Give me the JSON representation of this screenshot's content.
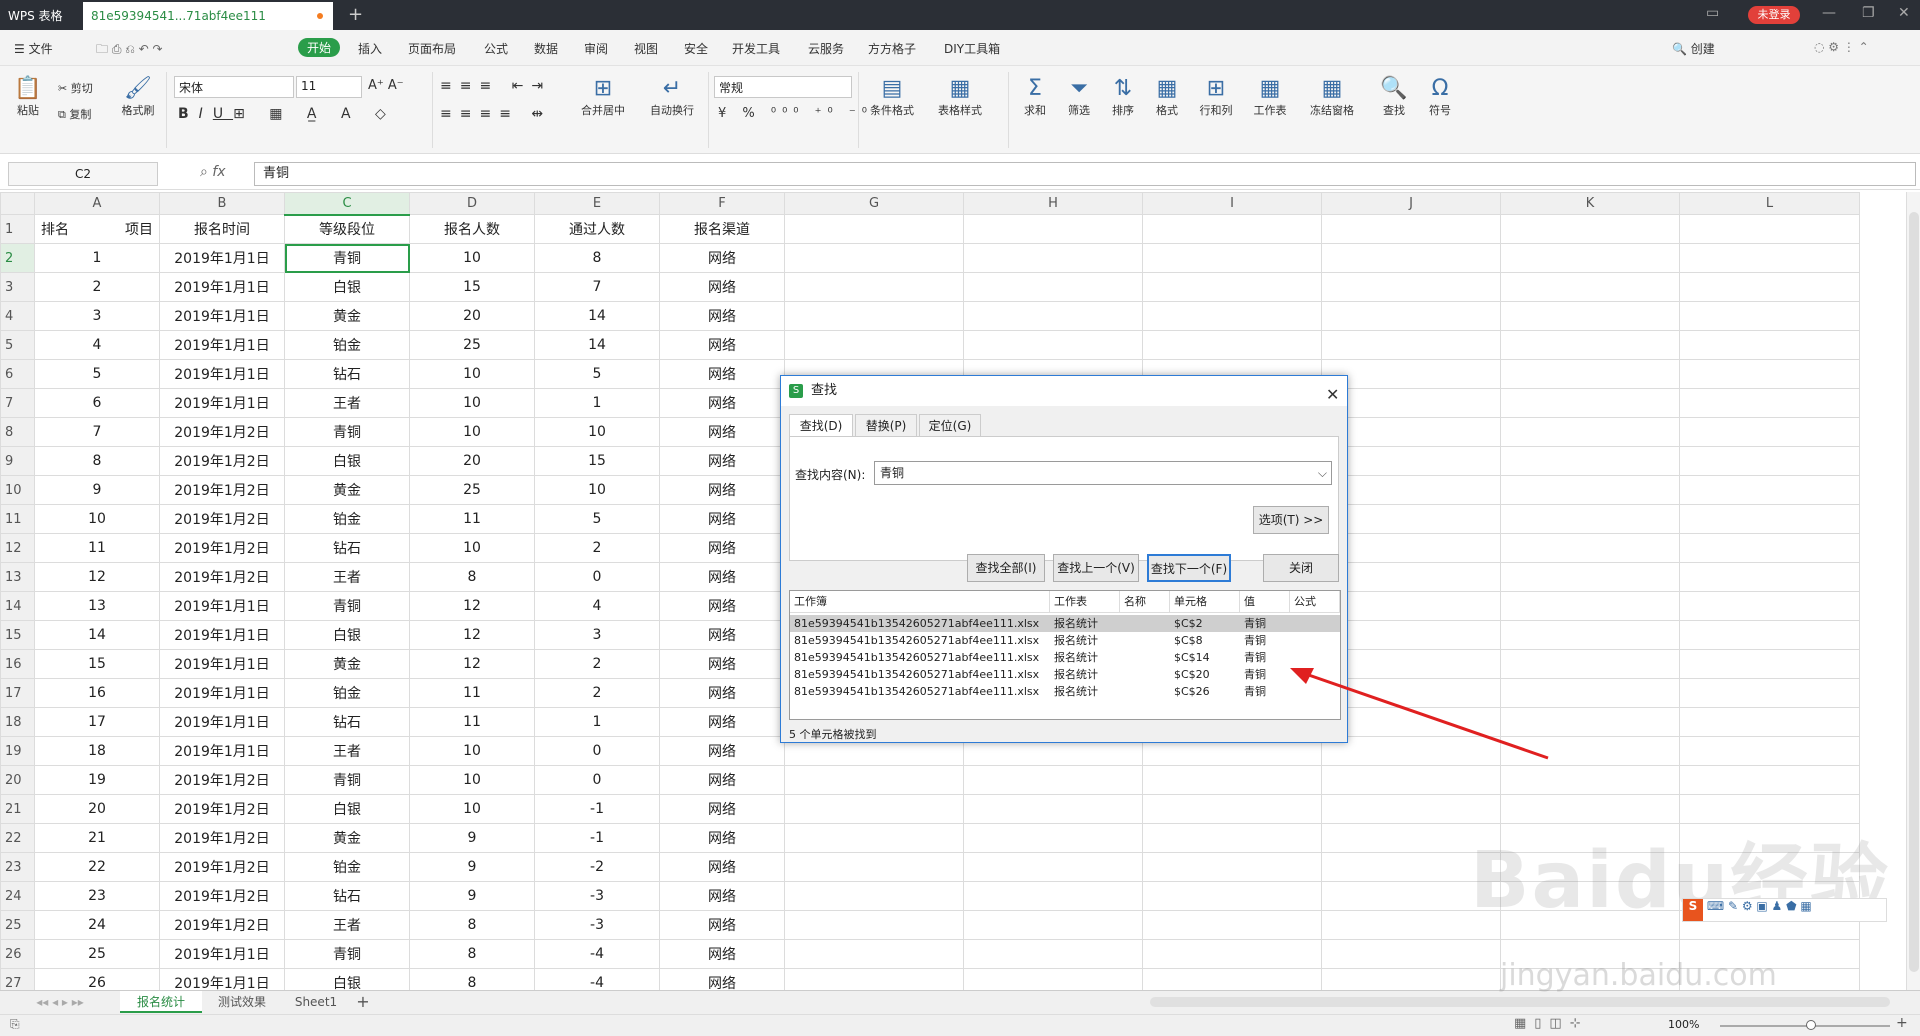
{
  "titlebar": {
    "app_tab": "WPS 表格",
    "doc_tab": "81e59394541...71abf4ee111",
    "login": "未登录"
  },
  "menu": {
    "file": "文件",
    "items": [
      "开始",
      "插入",
      "页面布局",
      "公式",
      "数据",
      "审阅",
      "视图",
      "安全",
      "开发工具",
      "云服务",
      "方方格子",
      "DIY工具箱"
    ],
    "search": "创建"
  },
  "ribbon": {
    "paste": "粘贴",
    "cut": "剪切",
    "copy": "复制",
    "format_painter": "格式刷",
    "font": "宋体",
    "size": "11",
    "number_format": "常规",
    "merge": "合并居中",
    "wrap": "自动换行",
    "cond_format": "条件格式",
    "table_style": "表格样式",
    "sum": "求和",
    "filter": "筛选",
    "sort": "排序",
    "format": "格式",
    "rowcol": "行和列",
    "sheet": "工作表",
    "freeze": "冻结窗格",
    "find": "查找",
    "symbol": "符号"
  },
  "formula": {
    "cell": "C2",
    "fx": "fx",
    "value": "青铜"
  },
  "columns": [
    "A",
    "B",
    "C",
    "D",
    "E",
    "F",
    "G",
    "H",
    "I",
    "J",
    "K",
    "L"
  ],
  "header": [
    "排名",
    "项目",
    "报名时间",
    "等级段位",
    "报名人数",
    "通过人数",
    "报名渠道"
  ],
  "rows": [
    [
      "1",
      "2019年1月1日",
      "青铜",
      "10",
      "8",
      "网络"
    ],
    [
      "2",
      "2019年1月1日",
      "白银",
      "15",
      "7",
      "网络"
    ],
    [
      "3",
      "2019年1月1日",
      "黄金",
      "20",
      "14",
      "网络"
    ],
    [
      "4",
      "2019年1月1日",
      "铂金",
      "25",
      "14",
      "网络"
    ],
    [
      "5",
      "2019年1月1日",
      "钻石",
      "10",
      "5",
      "网络"
    ],
    [
      "6",
      "2019年1月1日",
      "王者",
      "10",
      "1",
      "网络"
    ],
    [
      "7",
      "2019年1月2日",
      "青铜",
      "10",
      "10",
      "网络"
    ],
    [
      "8",
      "2019年1月2日",
      "白银",
      "20",
      "15",
      "网络"
    ],
    [
      "9",
      "2019年1月2日",
      "黄金",
      "25",
      "10",
      "网络"
    ],
    [
      "10",
      "2019年1月2日",
      "铂金",
      "11",
      "5",
      "网络"
    ],
    [
      "11",
      "2019年1月2日",
      "钻石",
      "10",
      "2",
      "网络"
    ],
    [
      "12",
      "2019年1月2日",
      "王者",
      "8",
      "0",
      "网络"
    ],
    [
      "13",
      "2019年1月1日",
      "青铜",
      "12",
      "4",
      "网络"
    ],
    [
      "14",
      "2019年1月1日",
      "白银",
      "12",
      "3",
      "网络"
    ],
    [
      "15",
      "2019年1月1日",
      "黄金",
      "12",
      "2",
      "网络"
    ],
    [
      "16",
      "2019年1月1日",
      "铂金",
      "11",
      "2",
      "网络"
    ],
    [
      "17",
      "2019年1月1日",
      "钻石",
      "11",
      "1",
      "网络"
    ],
    [
      "18",
      "2019年1月1日",
      "王者",
      "10",
      "0",
      "网络"
    ],
    [
      "19",
      "2019年1月2日",
      "青铜",
      "10",
      "0",
      "网络"
    ],
    [
      "20",
      "2019年1月2日",
      "白银",
      "10",
      "-1",
      "网络"
    ],
    [
      "21",
      "2019年1月2日",
      "黄金",
      "9",
      "-1",
      "网络"
    ],
    [
      "22",
      "2019年1月2日",
      "铂金",
      "9",
      "-2",
      "网络"
    ],
    [
      "23",
      "2019年1月2日",
      "钻石",
      "9",
      "-3",
      "网络"
    ],
    [
      "24",
      "2019年1月2日",
      "王者",
      "8",
      "-3",
      "网络"
    ],
    [
      "25",
      "2019年1月1日",
      "青铜",
      "8",
      "-4",
      "网络"
    ],
    [
      "26",
      "2019年1月1日",
      "白银",
      "8",
      "-4",
      "网络"
    ]
  ],
  "sheets": [
    "报名统计",
    "测试效果",
    "Sheet1"
  ],
  "status": {
    "zoom": "100%"
  },
  "dialog": {
    "title": "查找",
    "tabs": [
      "查找(D)",
      "替换(P)",
      "定位(G)"
    ],
    "label": "查找内容(N):",
    "value": "青铜",
    "options": "选项(T) >>",
    "find_all": "查找全部(I)",
    "find_prev": "查找上一个(V)",
    "find_next": "查找下一个(F)",
    "close": "关闭",
    "cols": [
      "工作簿",
      "工作表",
      "名称",
      "单元格",
      "值",
      "公式"
    ],
    "results": [
      [
        "81e59394541b13542605271abf4ee111.xlsx",
        "报名统计",
        "",
        "$C$2",
        "青铜"
      ],
      [
        "81e59394541b13542605271abf4ee111.xlsx",
        "报名统计",
        "",
        "$C$8",
        "青铜"
      ],
      [
        "81e59394541b13542605271abf4ee111.xlsx",
        "报名统计",
        "",
        "$C$14",
        "青铜"
      ],
      [
        "81e59394541b13542605271abf4ee111.xlsx",
        "报名统计",
        "",
        "$C$20",
        "青铜"
      ],
      [
        "81e59394541b13542605271abf4ee111.xlsx",
        "报名统计",
        "",
        "$C$26",
        "青铜"
      ]
    ],
    "found": "5 个单元格被找到"
  },
  "watermark": {
    "main": "Baidu经验",
    "sub": "jingyan.baidu.com"
  },
  "colors": {
    "accent": "#2a9d4a",
    "arrow": "#e02020",
    "dialog_border": "#2d7bd6"
  }
}
